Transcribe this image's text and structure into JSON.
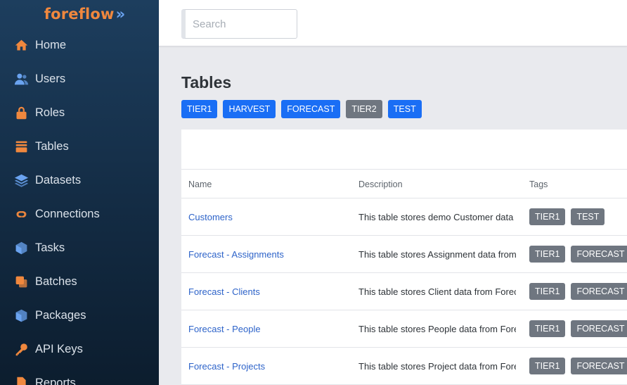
{
  "brand": {
    "name": "foreflow",
    "mark": "»"
  },
  "sidebar": {
    "items": [
      {
        "label": "Home",
        "icon": "home-icon",
        "color": "#f0883e"
      },
      {
        "label": "Users",
        "icon": "users-icon",
        "color": "#6aa3f0"
      },
      {
        "label": "Roles",
        "icon": "lock-icon",
        "color": "#f0883e"
      },
      {
        "label": "Tables",
        "icon": "table-icon",
        "color": "#f0883e"
      },
      {
        "label": "Datasets",
        "icon": "layers-icon",
        "color": "#6aa3f0"
      },
      {
        "label": "Connections",
        "icon": "link-icon",
        "color": "#f0883e"
      },
      {
        "label": "Tasks",
        "icon": "cube-icon",
        "color": "#6aa3f0"
      },
      {
        "label": "Batches",
        "icon": "copy-icon",
        "color": "#f0883e"
      },
      {
        "label": "Packages",
        "icon": "box-icon",
        "color": "#6aa3f0"
      },
      {
        "label": "API Keys",
        "icon": "key-icon",
        "color": "#f0883e"
      },
      {
        "label": "Reports",
        "icon": "document-icon",
        "color": "#f0883e"
      }
    ]
  },
  "search": {
    "placeholder": "Search",
    "value": ""
  },
  "page": {
    "title": "Tables"
  },
  "filters": [
    {
      "label": "TIER1",
      "color": "#1a6ef5"
    },
    {
      "label": "HARVEST",
      "color": "#1a6ef5"
    },
    {
      "label": "FORECAST",
      "color": "#1a6ef5"
    },
    {
      "label": "TIER2",
      "color": "#6f7680"
    },
    {
      "label": "TEST",
      "color": "#1a6ef5"
    }
  ],
  "table": {
    "columns": [
      "Name",
      "Description",
      "Tags"
    ],
    "rows": [
      {
        "name": "Customers",
        "description": "This table stores demo Customer data",
        "tags": [
          "TIER1",
          "TEST"
        ]
      },
      {
        "name": "Forecast - Assignments",
        "description": "This table stores Assignment data from Forecast",
        "tags": [
          "TIER1",
          "FORECAST"
        ]
      },
      {
        "name": "Forecast - Clients",
        "description": "This table stores Client data from Forecast",
        "tags": [
          "TIER1",
          "FORECAST"
        ]
      },
      {
        "name": "Forecast - People",
        "description": "This table stores People data from Forecast",
        "tags": [
          "TIER1",
          "FORECAST"
        ]
      },
      {
        "name": "Forecast - Projects",
        "description": "This table stores Project data from Forecast",
        "tags": [
          "TIER1",
          "FORECAST"
        ]
      }
    ]
  }
}
